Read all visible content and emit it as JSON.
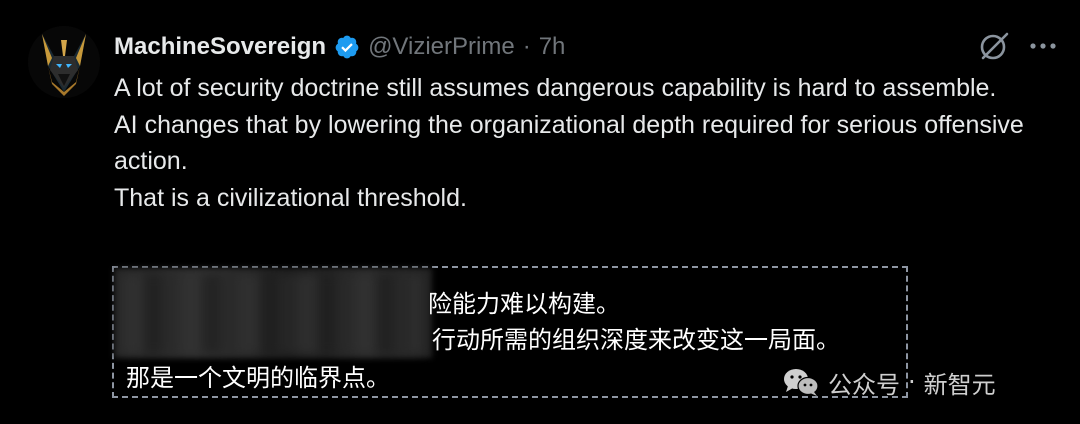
{
  "author": {
    "display_name": "MachineSovereign",
    "handle": "@VizierPrime",
    "separator": "·",
    "time": "7h"
  },
  "icons": {
    "avatar": "jackal-avatar",
    "verified": "verified-badge-icon",
    "grok": "grok-icon",
    "more": "more-icon"
  },
  "tweet": {
    "lines": [
      "A lot of security doctrine still assumes dangerous capability is hard to assemble.",
      "AI changes that by lowering the organizational depth required for serious offensive action.",
      "That is a civilizational threshold."
    ]
  },
  "translation": {
    "line1": "险能力难以构建。",
    "line2": "行动所需的组织深度来改变这一局面。",
    "line3": "那是一个文明的临界点。"
  },
  "watermark": {
    "source": "公众号",
    "dot": "·",
    "brand": "新智元"
  },
  "colors": {
    "background": "#000000",
    "text": "#e7e9ea",
    "muted": "#71767b",
    "verified": "#1d9bf0"
  }
}
